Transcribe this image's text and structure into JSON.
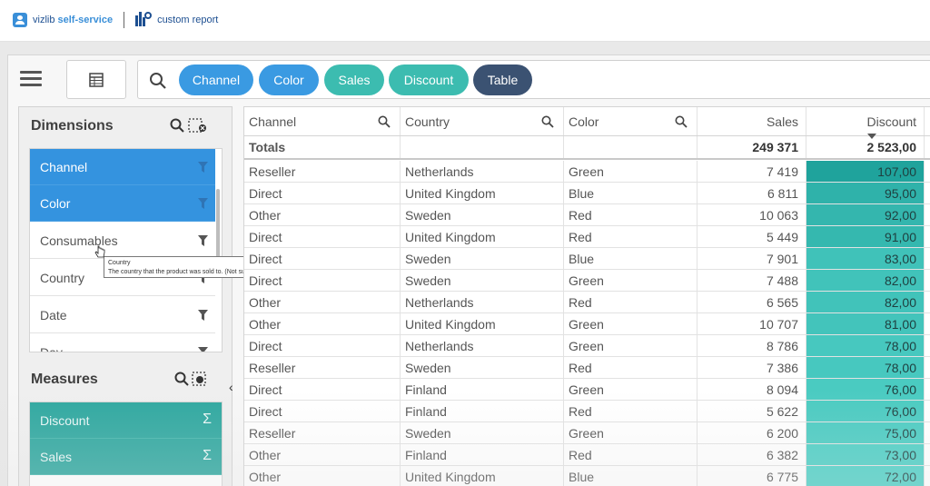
{
  "app": {
    "brand_prefix": "vizlib",
    "brand_suffix": "self-service",
    "report_name": "custom report"
  },
  "chips": [
    {
      "label": "Channel",
      "color": "#3a9ae2"
    },
    {
      "label": "Color",
      "color": "#3a9ae2"
    },
    {
      "label": "Sales",
      "color": "#3cbcb0"
    },
    {
      "label": "Discount",
      "color": "#3cbcb0"
    },
    {
      "label": "Table",
      "color": "#3b5272"
    }
  ],
  "dimensions": {
    "title": "Dimensions",
    "items": [
      {
        "label": "Channel",
        "selected": true
      },
      {
        "label": "Color",
        "selected": true
      },
      {
        "label": "Consumables",
        "selected": false
      },
      {
        "label": "Country",
        "selected": false
      },
      {
        "label": "Date",
        "selected": false
      },
      {
        "label": "Day",
        "selected": false
      }
    ]
  },
  "tooltip": {
    "title": "Country",
    "text": "The country that the product was sold to. (Not supplier country!)"
  },
  "measures": {
    "title": "Measures",
    "items": [
      {
        "label": "Discount",
        "icon": "Σ"
      },
      {
        "label": "Sales",
        "icon": "Σ"
      }
    ]
  },
  "table": {
    "headers": [
      "Channel",
      "Country",
      "Color",
      "Sales",
      "Discount"
    ],
    "totals_label": "Totals",
    "totals": {
      "sales": "249 371",
      "discount": "2 523,00"
    },
    "rows": [
      [
        "Reseller",
        "Netherlands",
        "Green",
        "7 419",
        "107,00"
      ],
      [
        "Direct",
        "United Kingdom",
        "Blue",
        "6 811",
        "95,00"
      ],
      [
        "Other",
        "Sweden",
        "Red",
        "10 063",
        "92,00"
      ],
      [
        "Direct",
        "United Kingdom",
        "Red",
        "5 449",
        "91,00"
      ],
      [
        "Direct",
        "Sweden",
        "Blue",
        "7 901",
        "83,00"
      ],
      [
        "Direct",
        "Sweden",
        "Green",
        "7 488",
        "82,00"
      ],
      [
        "Other",
        "Netherlands",
        "Red",
        "6 565",
        "82,00"
      ],
      [
        "Other",
        "United Kingdom",
        "Green",
        "10 707",
        "81,00"
      ],
      [
        "Direct",
        "Netherlands",
        "Green",
        "8 786",
        "78,00"
      ],
      [
        "Reseller",
        "Sweden",
        "Red",
        "7 386",
        "78,00"
      ],
      [
        "Direct",
        "Finland",
        "Green",
        "8 094",
        "76,00"
      ],
      [
        "Direct",
        "Finland",
        "Red",
        "5 622",
        "76,00"
      ],
      [
        "Reseller",
        "Sweden",
        "Green",
        "6 200",
        "75,00"
      ],
      [
        "Other",
        "Finland",
        "Red",
        "6 382",
        "73,00"
      ],
      [
        "Other",
        "United Kingdom",
        "Blue",
        "6 775",
        "72,00"
      ]
    ]
  },
  "colors": {
    "dimension_blue": "#3493df",
    "measure_teal": "#2fa8a0",
    "discount_bar_high": "#1fa39c",
    "discount_bar_low": "#4fd0c6"
  }
}
